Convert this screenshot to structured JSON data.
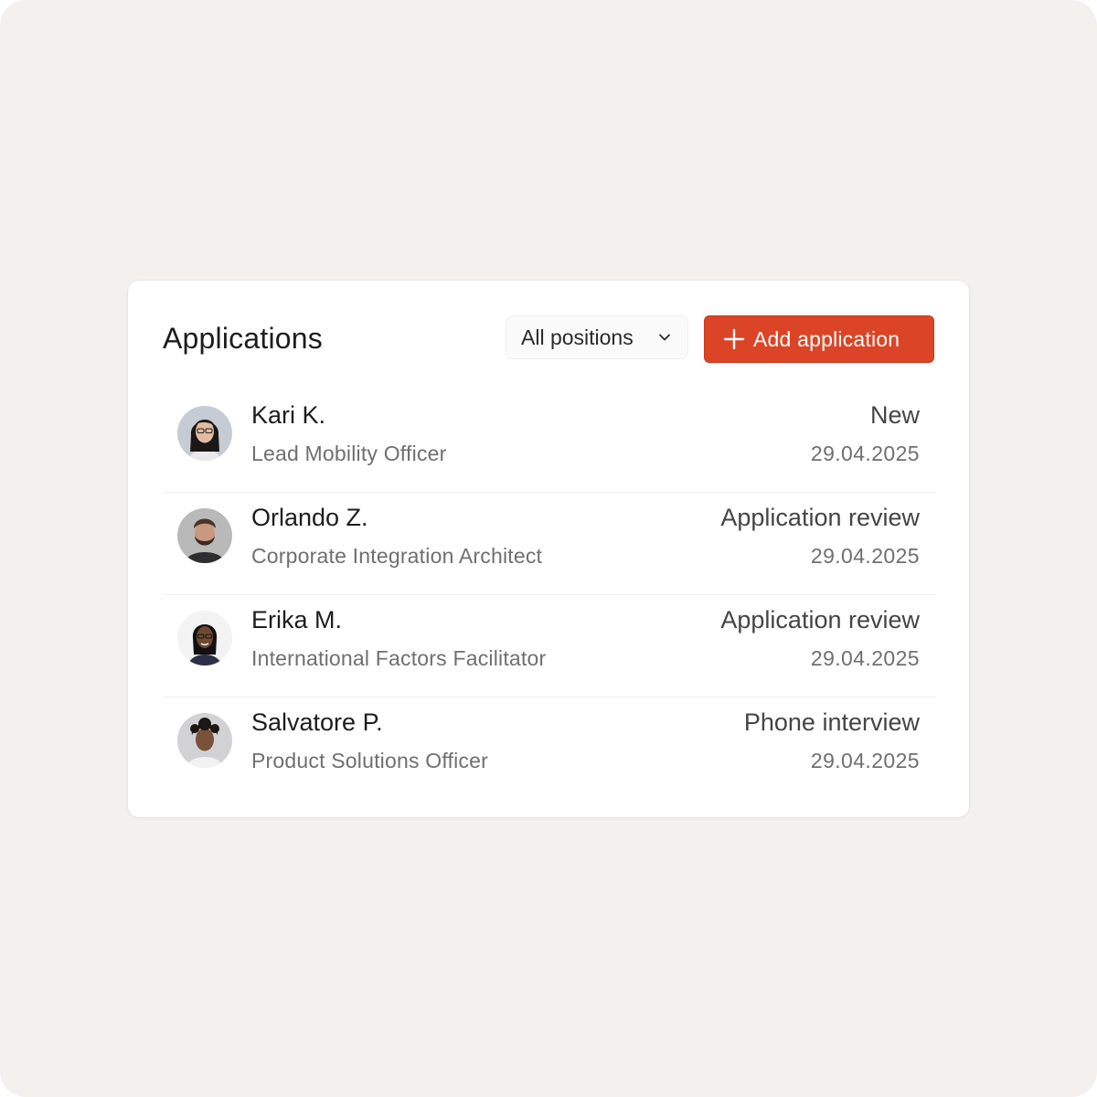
{
  "panel": {
    "title": "Applications",
    "filter": {
      "selected": "All positions",
      "icon": "chevron-down-icon"
    },
    "add_button": {
      "label": "Add application",
      "icon": "plus-icon"
    }
  },
  "applications": [
    {
      "name": "Kari K.",
      "role": "Lead Mobility Officer",
      "status": "New",
      "date": "29.04.2025"
    },
    {
      "name": "Orlando Z.",
      "role": "Corporate Integration Architect",
      "status": "Application review",
      "date": "29.04.2025"
    },
    {
      "name": "Erika M.",
      "role": "International Factors Facilitator",
      "status": "Application review",
      "date": "29.04.2025"
    },
    {
      "name": "Salvatore P.",
      "role": "Product Solutions Officer",
      "status": "Phone interview",
      "date": "29.04.2025"
    }
  ],
  "colors": {
    "background": "#f4f0ee",
    "card": "#ffffff",
    "accent": "#db4426",
    "text_primary": "#1d1d1d",
    "text_secondary": "#6f6f6f"
  }
}
